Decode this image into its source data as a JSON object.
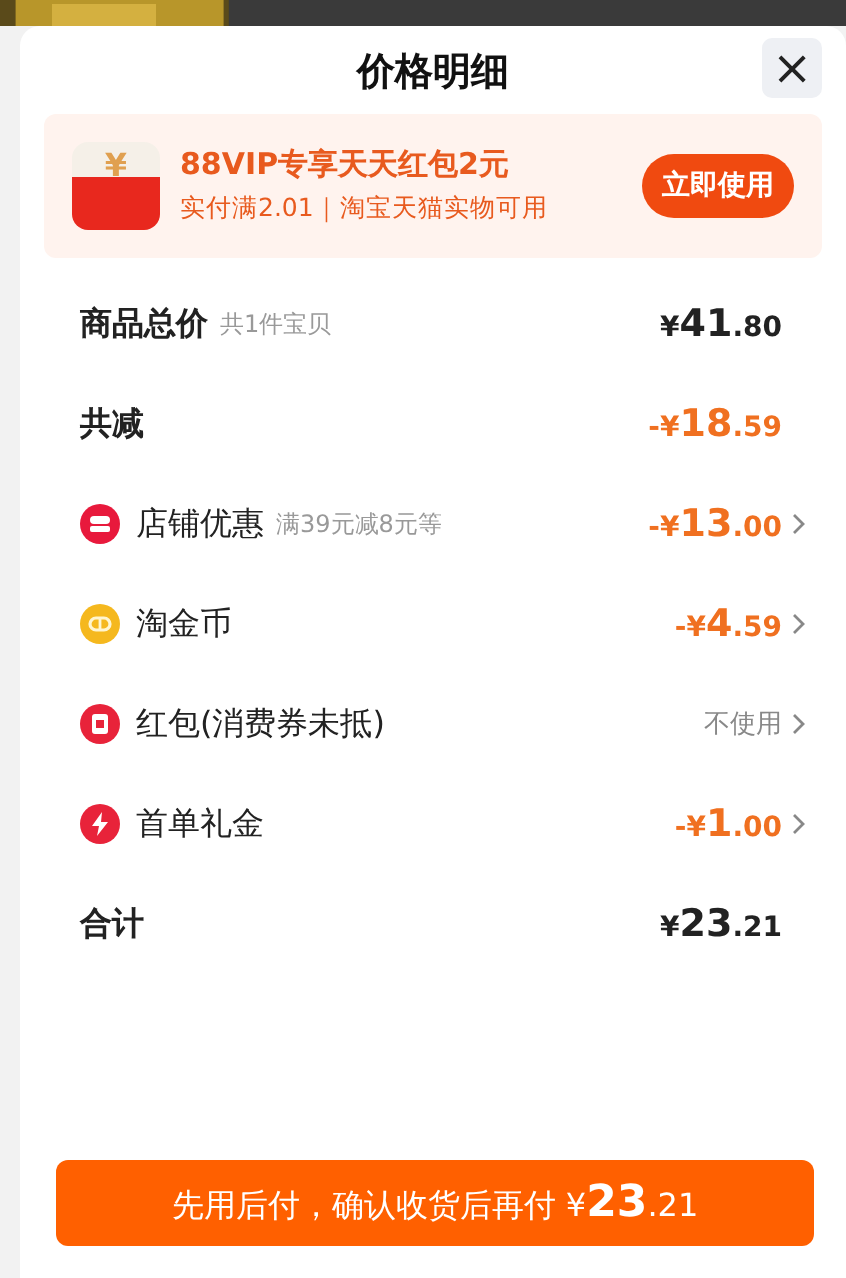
{
  "sheet": {
    "title": "价格明细",
    "close_label": "×"
  },
  "promo": {
    "icon_text": "¥",
    "title": "88VIP专享天天红包2元",
    "subtitle": "实付满2.01｜淘宝天猫实物可用",
    "button": "立即使用"
  },
  "rows": [
    {
      "kind": "summary",
      "label": "商品总价",
      "note": "共1件宝贝",
      "amount": {
        "kind": "plain",
        "text": "¥**41**.80"
      }
    },
    {
      "kind": "summary",
      "label": "共减",
      "amount": {
        "kind": "discount",
        "text": "-¥**18**.59"
      }
    },
    {
      "kind": "item",
      "label": "店铺优惠",
      "note": "满39元减8元等",
      "amount": {
        "kind": "discount",
        "text": "-¥**13**.00"
      }
    },
    {
      "kind": "item",
      "label": "淘金币",
      "amount": {
        "kind": "discount",
        "text": "-¥**4**.59"
      }
    },
    {
      "kind": "item",
      "label": "红包(消费券未抵)",
      "amount": {
        "kind": "muted",
        "text": "不使用"
      }
    },
    {
      "kind": "item",
      "label": "首单礼金",
      "amount": {
        "kind": "discount",
        "text": "-¥**1**.00"
      }
    },
    {
      "kind": "summary",
      "label": "合计",
      "amount": {
        "kind": "plain",
        "text": "¥**23**.21"
      }
    }
  ],
  "pay_button": "先用后付，确认收货后再付 ¥**23**.21"
}
